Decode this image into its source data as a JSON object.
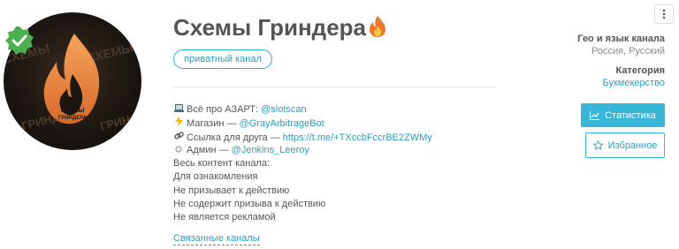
{
  "channel": {
    "title": "Схемы Гриндера",
    "privacy_badge": "приватный канал",
    "avatar_text": "СХЕМЫ ГРИНДЕРА",
    "description": [
      {
        "icon": "laptop-icon",
        "prefix": "Всё про АЗАРТ: ",
        "link": "@slotscan"
      },
      {
        "icon": "lightning-icon",
        "prefix": "Магазин — ",
        "link": "@GrayArbitrageBot"
      },
      {
        "icon": "link-icon",
        "prefix": "Ссылка для друга — ",
        "link": "https://t.me/+TXccbFccrBE2ZWMy"
      },
      {
        "icon": "circle-icon",
        "prefix": "Админ — ",
        "link": "@Jenkins_Leeroy"
      },
      {
        "text": "Весь контент канала:"
      },
      {
        "text": "Для ознакомления"
      },
      {
        "text": "Не призывает к действию"
      },
      {
        "text": "Не содержит призыва к действию"
      },
      {
        "text": "Не является рекламой"
      }
    ],
    "related_link": "Связанные каналы"
  },
  "sidebar": {
    "geo_label": "Гео и язык канала",
    "geo_value": "Россия, Русский",
    "category_label": "Категория",
    "category_value": "Букмекерство",
    "stats_button": "Статистика",
    "favorite_button": "Избранное"
  },
  "colors": {
    "accent": "#38b6d8",
    "link": "#2a9fc0",
    "verified": "#4caf50",
    "fire": "#f0782c"
  }
}
